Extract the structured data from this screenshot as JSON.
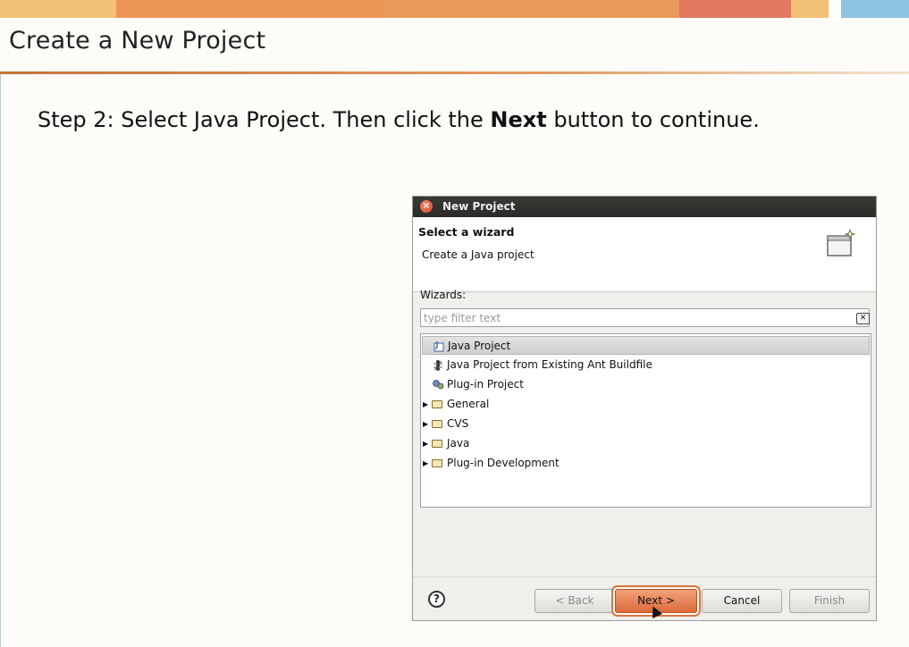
{
  "colors": {
    "bar_segments": [
      "#f3c175",
      "#ec9656",
      "#e79a5b",
      "#e17a60",
      "#f3c176",
      "#ffffff",
      "#8ec4e2"
    ],
    "accent": "#dc6b3b"
  },
  "slide": {
    "title": "Create a New Project",
    "step_prefix": "Step 2: Select Java Project. Then click the ",
    "step_bold": "Next",
    "step_suffix": " button to continue."
  },
  "dialog": {
    "title": "New Project",
    "close_icon": "close-icon",
    "banner_heading": "Select a wizard",
    "banner_description": "Create a Java project",
    "wizards_label": "Wizards:",
    "filter_placeholder": "type filter text",
    "tree": [
      {
        "label": "Java Project",
        "icon": "java-project-icon",
        "selected": true,
        "expandable": false
      },
      {
        "label": "Java Project from Existing Ant Buildfile",
        "icon": "ant-icon",
        "selected": false,
        "expandable": false
      },
      {
        "label": "Plug-in Project",
        "icon": "plugin-icon",
        "selected": false,
        "expandable": false
      },
      {
        "label": "General",
        "icon": "folder-icon",
        "selected": false,
        "expandable": true
      },
      {
        "label": "CVS",
        "icon": "folder-icon",
        "selected": false,
        "expandable": true
      },
      {
        "label": "Java",
        "icon": "folder-icon",
        "selected": false,
        "expandable": true
      },
      {
        "label": "Plug-in Development",
        "icon": "folder-icon",
        "selected": false,
        "expandable": true
      }
    ],
    "buttons": {
      "help": "?",
      "back": "< Back",
      "next": "Next >",
      "cancel": "Cancel",
      "finish": "Finish"
    }
  }
}
